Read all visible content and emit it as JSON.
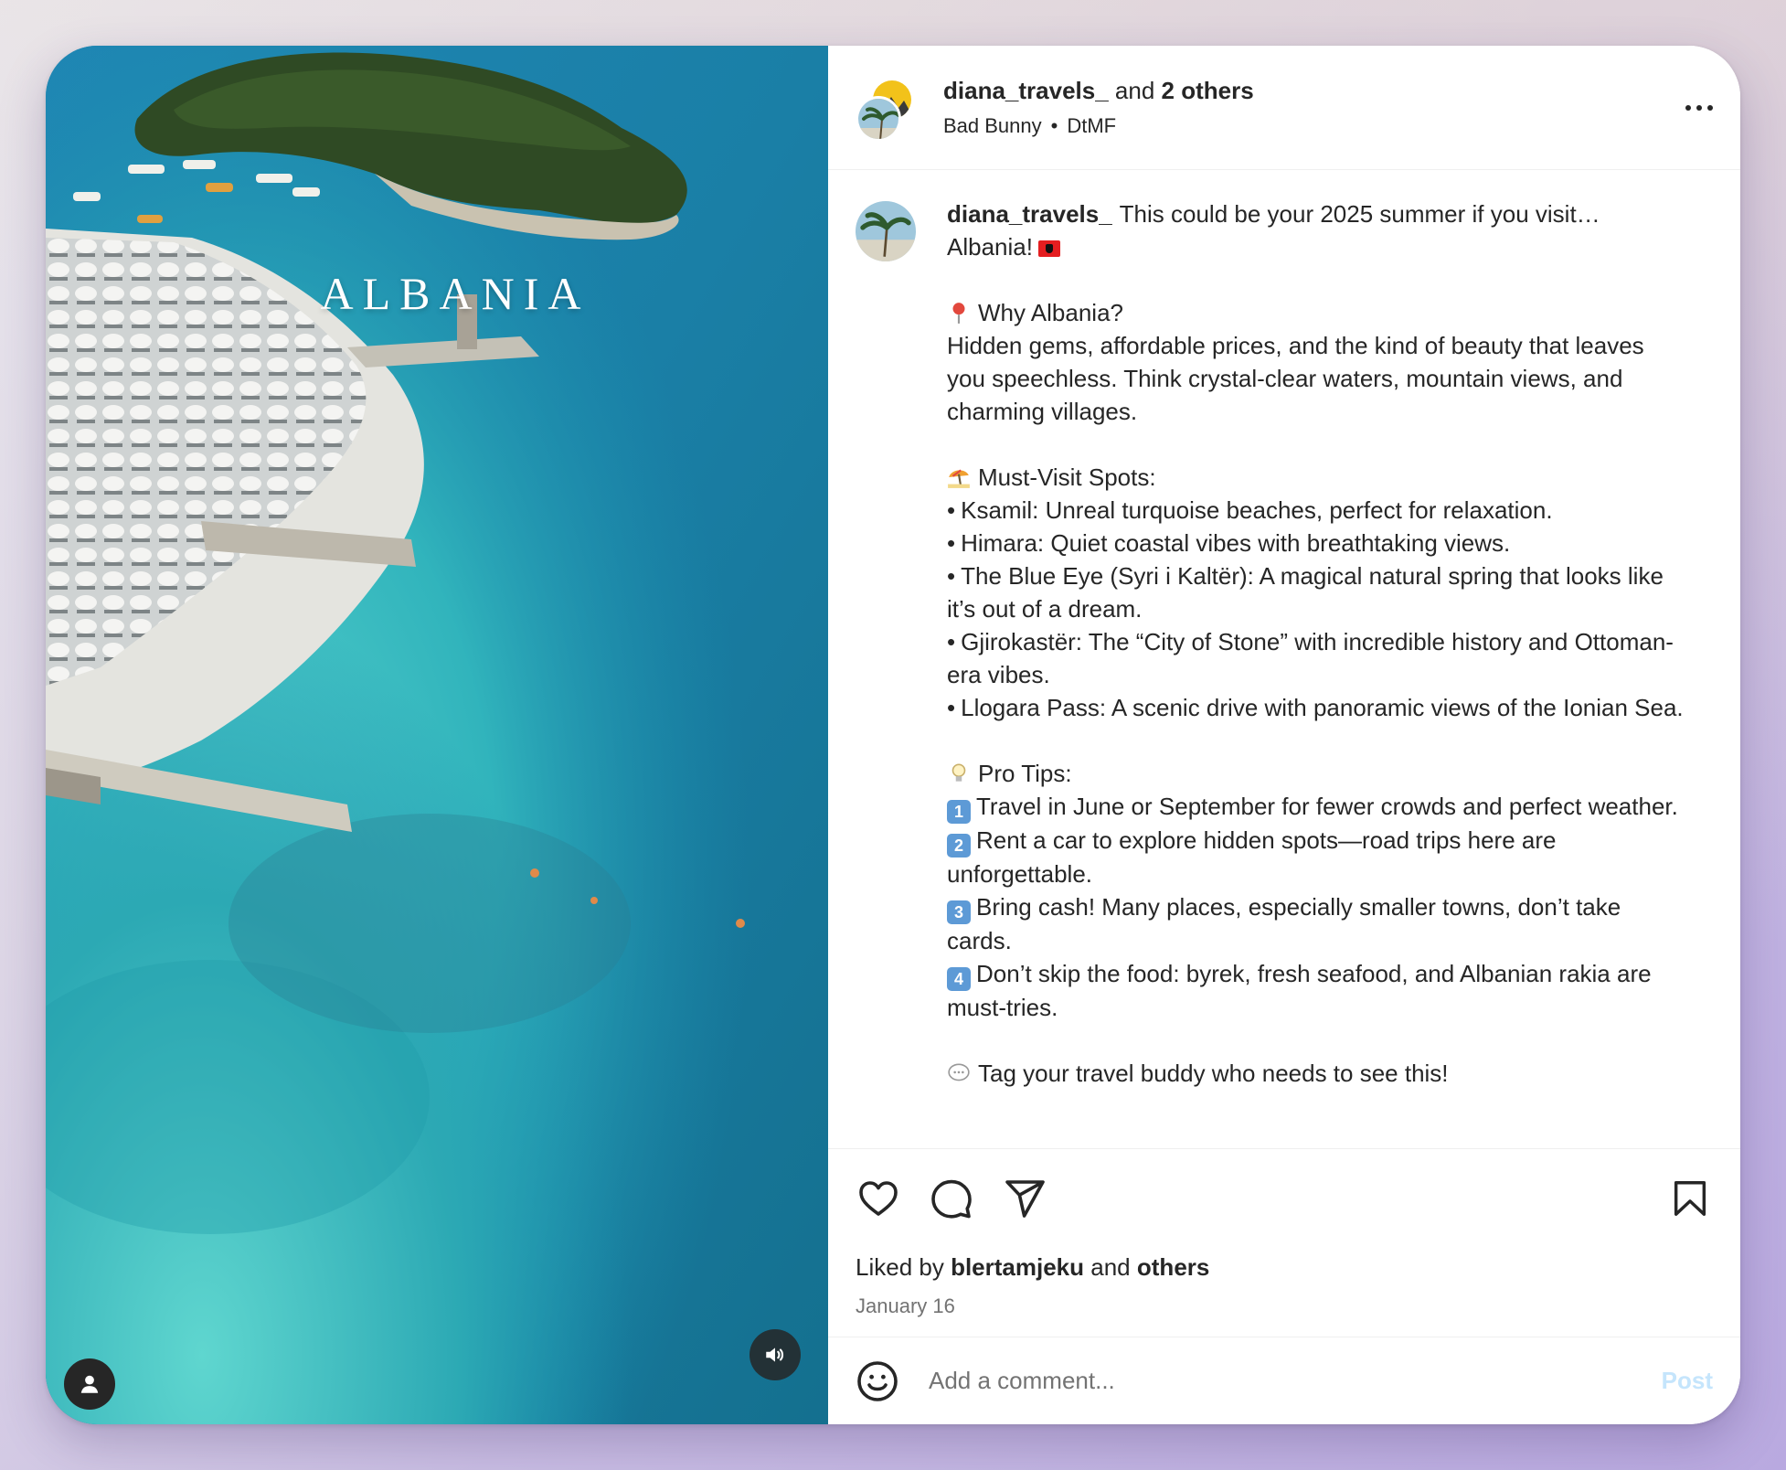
{
  "media": {
    "overlay_title": "ALBANIA",
    "user_tag_icon": "user-icon",
    "mute_icon": "speaker-icon"
  },
  "header": {
    "username": "diana_travels_",
    "and_text": "and",
    "others": "2 others",
    "audio_artist": "Bad Bunny",
    "audio_separator": "•",
    "audio_track": "DtMF",
    "more_icon": "more-horizontal-icon"
  },
  "caption": {
    "username": "diana_travels_",
    "intro": "This could be your 2025 summer if you visit… Albania!",
    "why_heading": "Why Albania?",
    "why_body": "Hidden gems, affordable prices, and the kind of beauty that leaves you speechless. Think crystal-clear waters, mountain views, and charming villages.",
    "spots_heading": "Must-Visit Spots:",
    "spots": [
      "Ksamil: Unreal turquoise beaches, perfect for relaxation.",
      "Himara: Quiet coastal vibes with breathtaking views.",
      "The Blue Eye (Syri i Kaltër): A magical natural spring that looks like it’s out of a dream.",
      "Gjirokastër: The “City of Stone” with incredible history and Ottoman-era vibes.",
      "Llogara Pass: A scenic drive with panoramic views of the Ionian Sea."
    ],
    "tips_heading": "Pro Tips:",
    "tips": [
      {
        "num": "1",
        "text": "Travel in June or September for fewer crowds and perfect weather."
      },
      {
        "num": "2",
        "text": "Rent a car to explore hidden spots—road trips here are unforgettable."
      },
      {
        "num": "3",
        "text": "Bring cash! Many places, especially smaller towns, don’t take cards."
      },
      {
        "num": "4",
        "text": "Don’t skip the food: byrek, fresh seafood, and Albanian rakia are must-tries."
      }
    ],
    "closing": "Tag your travel buddy who needs to see this!",
    "bullet": "•"
  },
  "actions": {
    "like_icon": "heart-icon",
    "comment_icon": "comment-icon",
    "share_icon": "send-icon",
    "save_icon": "bookmark-icon",
    "liked_by_prefix": "Liked by",
    "liked_by_user": "blertamjeku",
    "liked_by_and": "and",
    "liked_by_others": "others",
    "date": "January 16"
  },
  "comment": {
    "emoji_icon": "smiley-icon",
    "placeholder": "Add a comment...",
    "post_label": "Post"
  },
  "colors": {
    "post_disabled": "#c5e5fc",
    "muted_text": "#737373",
    "text": "#262626"
  }
}
